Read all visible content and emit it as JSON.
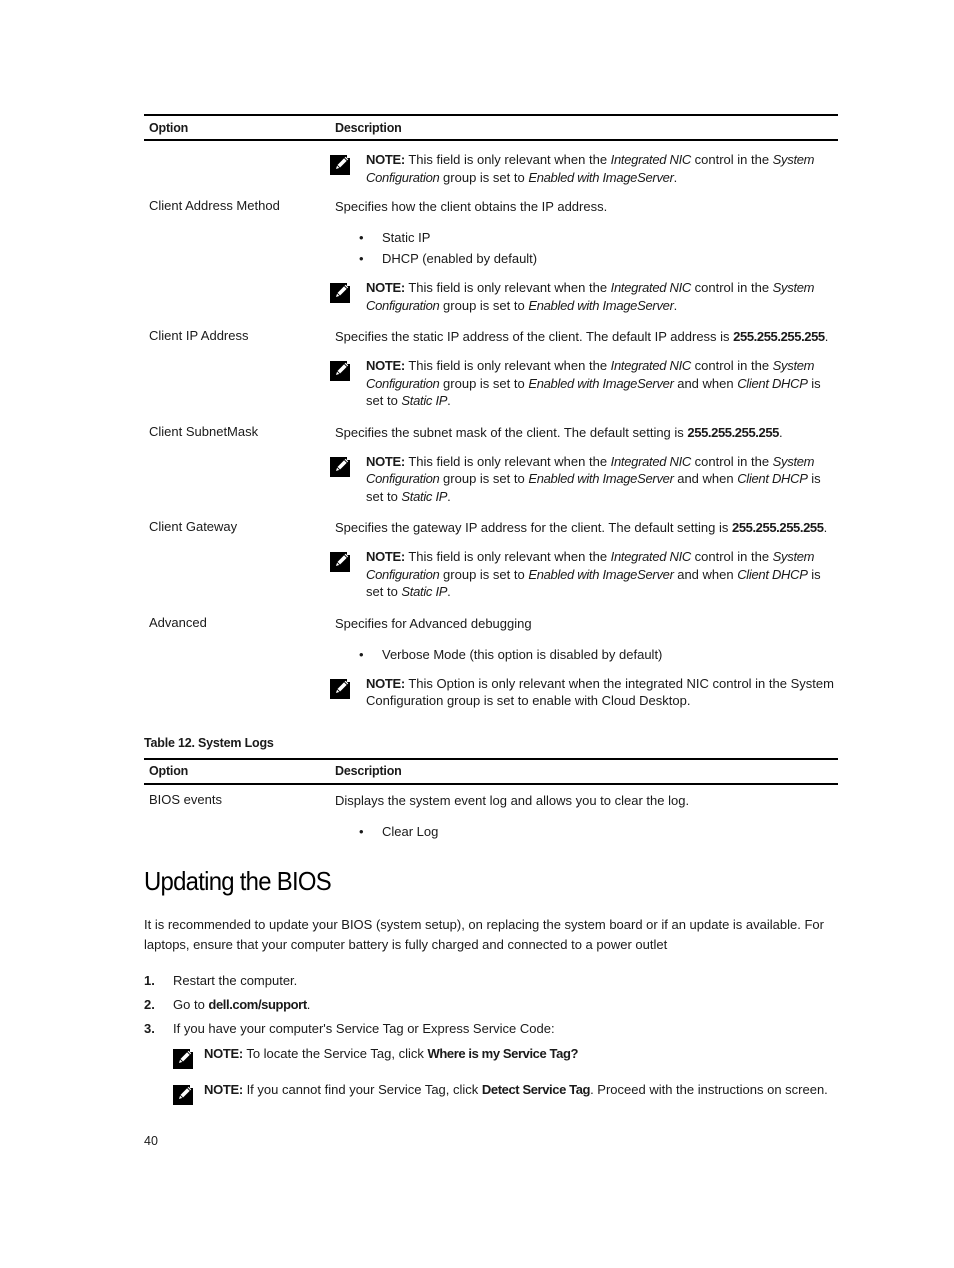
{
  "table_top": {
    "headers": {
      "option": "Option",
      "description": "Description"
    },
    "rows": [
      {
        "option": "",
        "description": "",
        "bullets": [],
        "note": {
          "label": "NOTE:",
          "parts": [
            {
              "t": " This field is only relevant when the ",
              "s": "n"
            },
            {
              "t": "Integrated NIC",
              "s": "i"
            },
            {
              "t": " control in the ",
              "s": "n"
            },
            {
              "t": "System Configuration",
              "s": "i"
            },
            {
              "t": " group is set to ",
              "s": "n"
            },
            {
              "t": "Enabled with ImageServer",
              "s": "i"
            },
            {
              "t": ".",
              "s": "n"
            }
          ]
        }
      },
      {
        "option": "Client Address Method",
        "description_parts": [
          {
            "t": "Specifies how the client obtains the IP address.",
            "s": "n"
          }
        ],
        "bullets": [
          "Static IP",
          "DHCP (enabled by default)"
        ],
        "note": {
          "label": "NOTE:",
          "parts": [
            {
              "t": " This field is only relevant when the ",
              "s": "n"
            },
            {
              "t": "Integrated NIC",
              "s": "i"
            },
            {
              "t": " control in the ",
              "s": "n"
            },
            {
              "t": "System Configuration",
              "s": "i"
            },
            {
              "t": " group is set to ",
              "s": "n"
            },
            {
              "t": "Enabled with ImageServer",
              "s": "i"
            },
            {
              "t": ".",
              "s": "n"
            }
          ]
        }
      },
      {
        "option": "Client IP Address",
        "description_parts": [
          {
            "t": "Specifies the static IP address of the client. The default IP address is ",
            "s": "n"
          },
          {
            "t": "255.255.255.255",
            "s": "b"
          },
          {
            "t": ".",
            "s": "n"
          }
        ],
        "bullets": [],
        "note": {
          "label": "NOTE:",
          "parts": [
            {
              "t": " This field is only relevant when the ",
              "s": "n"
            },
            {
              "t": "Integrated NIC",
              "s": "i"
            },
            {
              "t": " control in the ",
              "s": "n"
            },
            {
              "t": "System Configuration",
              "s": "i"
            },
            {
              "t": " group is set to ",
              "s": "n"
            },
            {
              "t": "Enabled with ImageServer",
              "s": "i"
            },
            {
              "t": " and when ",
              "s": "n"
            },
            {
              "t": "Client DHCP",
              "s": "i"
            },
            {
              "t": " is set to ",
              "s": "n"
            },
            {
              "t": "Static IP",
              "s": "i"
            },
            {
              "t": ".",
              "s": "n"
            }
          ]
        }
      },
      {
        "option": "Client SubnetMask",
        "description_parts": [
          {
            "t": "Specifies the subnet mask of the client. The default setting is ",
            "s": "n"
          },
          {
            "t": "255.255.255.255",
            "s": "b"
          },
          {
            "t": ".",
            "s": "n"
          }
        ],
        "bullets": [],
        "note": {
          "label": "NOTE:",
          "parts": [
            {
              "t": " This field is only relevant when the ",
              "s": "n"
            },
            {
              "t": "Integrated NIC",
              "s": "i"
            },
            {
              "t": " control in the ",
              "s": "n"
            },
            {
              "t": "System Configuration",
              "s": "i"
            },
            {
              "t": " group is set to ",
              "s": "n"
            },
            {
              "t": "Enabled with ImageServer",
              "s": "i"
            },
            {
              "t": " and when ",
              "s": "n"
            },
            {
              "t": "Client DHCP",
              "s": "i"
            },
            {
              "t": " is set to ",
              "s": "n"
            },
            {
              "t": "Static IP",
              "s": "i"
            },
            {
              "t": ".",
              "s": "n"
            }
          ]
        }
      },
      {
        "option": "Client Gateway",
        "description_parts": [
          {
            "t": "Specifies the gateway IP address for the client. The default setting is ",
            "s": "n"
          },
          {
            "t": "255.255.255.255",
            "s": "b"
          },
          {
            "t": ".",
            "s": "n"
          }
        ],
        "bullets": [],
        "note": {
          "label": "NOTE:",
          "parts": [
            {
              "t": " This field is only relevant when the ",
              "s": "n"
            },
            {
              "t": "Integrated NIC",
              "s": "i"
            },
            {
              "t": " control in the ",
              "s": "n"
            },
            {
              "t": "System Configuration",
              "s": "i"
            },
            {
              "t": " group is set to ",
              "s": "n"
            },
            {
              "t": "Enabled with ImageServer",
              "s": "i"
            },
            {
              "t": " and when ",
              "s": "n"
            },
            {
              "t": "Client DHCP",
              "s": "i"
            },
            {
              "t": " is set to ",
              "s": "n"
            },
            {
              "t": "Static IP",
              "s": "i"
            },
            {
              "t": ".",
              "s": "n"
            }
          ]
        }
      },
      {
        "option": "Advanced",
        "description_parts": [
          {
            "t": "Specifies for Advanced debugging",
            "s": "n"
          }
        ],
        "bullets": [
          "Verbose Mode (this option is disabled by default)"
        ],
        "note": {
          "label": "NOTE:",
          "parts": [
            {
              "t": " This Option is only relevant when the integrated NIC control in the System Configuration group is set to enable with Cloud Desktop.",
              "s": "n"
            }
          ]
        }
      }
    ]
  },
  "table_logs": {
    "caption": "Table 12. System Logs",
    "headers": {
      "option": "Option",
      "description": "Description"
    },
    "rows": [
      {
        "option": "BIOS events",
        "description": "Displays the system event log and allows you to clear the log.",
        "bullets": [
          "Clear Log"
        ]
      }
    ]
  },
  "section": {
    "title": "Updating the BIOS",
    "intro": "It is recommended to update your BIOS (system setup), on replacing the system board or if an update is available. For laptops, ensure that your computer battery is fully charged and connected to a power outlet",
    "steps": [
      {
        "num": "1.",
        "parts": [
          {
            "t": "Restart the computer.",
            "s": "n"
          }
        ]
      },
      {
        "num": "2.",
        "parts": [
          {
            "t": "Go to ",
            "s": "n"
          },
          {
            "t": "dell.com/support",
            "s": "b"
          },
          {
            "t": ".",
            "s": "n"
          }
        ]
      },
      {
        "num": "3.",
        "parts": [
          {
            "t": "If you have your computer's Service Tag or Express Service Code:",
            "s": "n"
          }
        ]
      }
    ],
    "step_notes": [
      {
        "label": "NOTE:",
        "parts": [
          {
            "t": " To locate the Service Tag, click ",
            "s": "n"
          },
          {
            "t": "Where is my Service Tag?",
            "s": "b"
          }
        ]
      },
      {
        "label": "NOTE:",
        "parts": [
          {
            "t": " If you cannot find your Service Tag, click ",
            "s": "n"
          },
          {
            "t": "Detect Service Tag",
            "s": "b"
          },
          {
            "t": ". Proceed with the instructions on screen.",
            "s": "n"
          }
        ]
      }
    ]
  },
  "footer": {
    "page_number": "40"
  },
  "icons": {
    "note": "pencil-note-icon"
  }
}
